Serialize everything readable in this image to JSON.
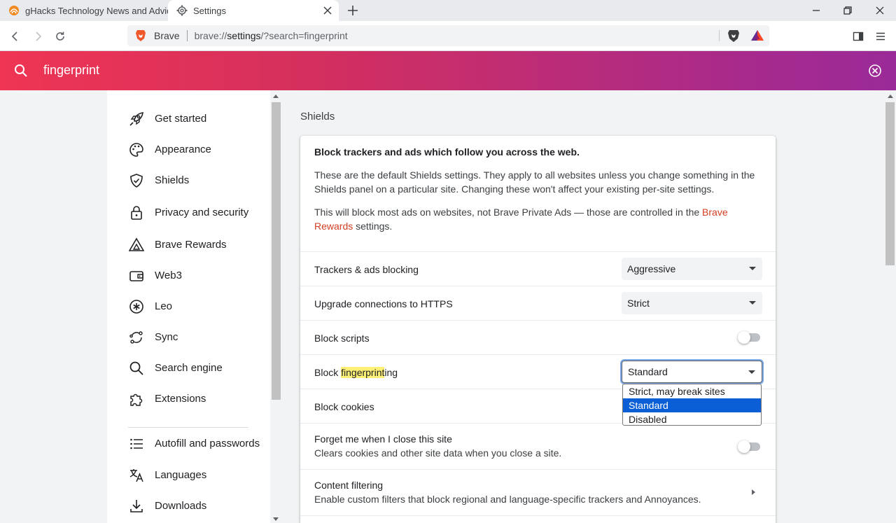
{
  "tabs": [
    {
      "title": "gHacks Technology News and Advice",
      "active": false
    },
    {
      "title": "Settings",
      "active": true
    }
  ],
  "omnibox": {
    "site_label": "Brave",
    "url_prefix": "brave://",
    "url_host": "settings",
    "url_rest": "/?search=fingerprint"
  },
  "search": {
    "term": "fingerprint"
  },
  "sidebar": {
    "items": [
      {
        "label": "Get started",
        "icon": "rocket-icon"
      },
      {
        "label": "Appearance",
        "icon": "palette-icon"
      },
      {
        "label": "Shields",
        "icon": "shield-icon"
      },
      {
        "label": "Privacy and security",
        "icon": "lock-icon"
      },
      {
        "label": "Brave Rewards",
        "icon": "bat-triangle-icon"
      },
      {
        "label": "Web3",
        "icon": "wallet-icon"
      },
      {
        "label": "Leo",
        "icon": "leo-asterisk-icon"
      },
      {
        "label": "Sync",
        "icon": "sync-icon"
      },
      {
        "label": "Search engine",
        "icon": "search-icon"
      },
      {
        "label": "Extensions",
        "icon": "puzzle-icon"
      },
      {
        "label": "Autofill and passwords",
        "icon": "list-icon"
      },
      {
        "label": "Languages",
        "icon": "translate-icon"
      },
      {
        "label": "Downloads",
        "icon": "download-icon"
      }
    ]
  },
  "main": {
    "section_title": "Shields",
    "card": {
      "heading": "Block trackers and ads which follow you across the web.",
      "para1": "These are the default Shields settings. They apply to all websites unless you change something in the Shields panel on a particular site. Changing these won't affect your existing per-site settings.",
      "para2_before": "This will block most ads on websites, not Brave Private Ads — those are controlled in the ",
      "para2_link": "Brave Rewards",
      "para2_after": " settings."
    },
    "rows": {
      "trackers": {
        "label": "Trackers & ads blocking",
        "value": "Aggressive"
      },
      "https": {
        "label": "Upgrade connections to HTTPS",
        "value": "Strict"
      },
      "scripts": {
        "label": "Block scripts",
        "enabled": false
      },
      "fingerprinting": {
        "label_before": "Block ",
        "label_highlight": "fingerprint",
        "label_after": "ing",
        "value": "Standard"
      },
      "cookies": {
        "label": "Block cookies"
      },
      "forget": {
        "label": "Forget me when I close this site",
        "sub": "Clears cookies and other site data when you close a site.",
        "enabled": false
      },
      "filtering": {
        "label": "Content filtering",
        "sub": "Enable custom filters that block regional and language-specific trackers and Annoyances."
      }
    },
    "dropdown": {
      "options": [
        "Strict, may break sites",
        "Standard",
        "Disabled"
      ],
      "selected": "Standard"
    }
  },
  "colors": {
    "banner_start": "#ef3553",
    "banner_end": "#9a2a98",
    "link": "#d43e23",
    "selected_option": "#0a5fd6",
    "highlight": "#fff176"
  }
}
